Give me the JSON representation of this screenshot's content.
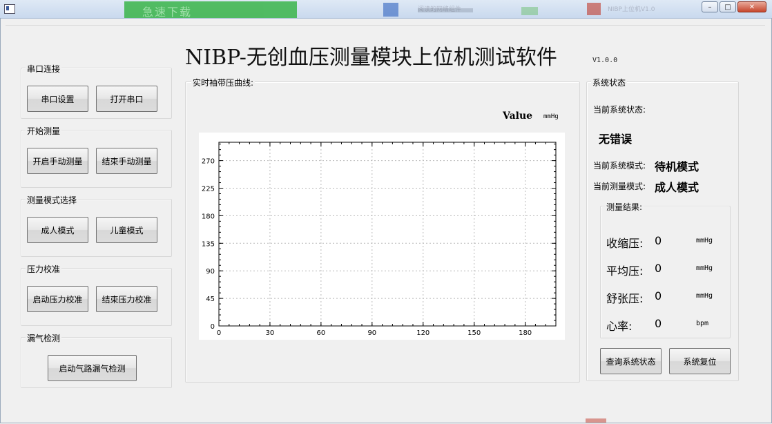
{
  "window": {
    "background_tabs": [
      "急速下载",
      "阅读的网络组件",
      "NIBP上位机V1.0"
    ],
    "controls": {
      "minimize": "–",
      "maximize": "□",
      "close": "✕"
    }
  },
  "header": {
    "title": "NIBP-无创血压测量模块上位机测试软件",
    "version": "V1.0.0"
  },
  "left_panel": {
    "serial": {
      "title": "串口连接",
      "settings_button": "串口设置",
      "open_button": "打开串口"
    },
    "measure": {
      "title": "开始测量",
      "start_button": "开启手动测量",
      "stop_button": "结束手动测量"
    },
    "mode": {
      "title": "测量模式选择",
      "adult_button": "成人模式",
      "child_button": "儿童模式"
    },
    "calibration": {
      "title": "压力校准",
      "start_button": "启动压力校准",
      "stop_button": "结束压力校准"
    },
    "leak": {
      "title": "漏气检测",
      "start_button": "启动气路漏气检测"
    }
  },
  "chart_panel": {
    "title": "实时袖带压曲线:",
    "value_label": "Value",
    "unit": "mmHg"
  },
  "chart_data": {
    "type": "line",
    "series": [],
    "x_ticks": [
      "0",
      "30",
      "60",
      "90",
      "120",
      "150",
      "180"
    ],
    "y_ticks": [
      "0",
      "45",
      "90",
      "135",
      "180",
      "225",
      "270"
    ],
    "xlim": [
      0,
      198
    ],
    "ylim": [
      0,
      300
    ],
    "grid": true,
    "xlabel": "",
    "ylabel": ""
  },
  "status_panel": {
    "title": "系统状态",
    "current_status_label": "当前系统状态:",
    "current_status_value": "无错误",
    "system_mode_label": "当前系统模式:",
    "system_mode_value": "待机模式",
    "measure_mode_label": "当前测量模式:",
    "measure_mode_value": "成人模式",
    "results_title": "测量结果:",
    "results": [
      {
        "label": "收缩压:",
        "value": "0",
        "unit": "mmHg"
      },
      {
        "label": "平均压:",
        "value": "0",
        "unit": "mmHg"
      },
      {
        "label": "舒张压:",
        "value": "0",
        "unit": "mmHg"
      },
      {
        "label": "心率:",
        "value": "0",
        "unit": "bpm"
      }
    ],
    "query_button": "查询系统状态",
    "reset_button": "系统复位"
  },
  "colors": {
    "window_bg": "#f0f0f0",
    "plot_bg": "#ffffff",
    "grid": "#b8b8b8",
    "close_button": "#c6462d"
  }
}
